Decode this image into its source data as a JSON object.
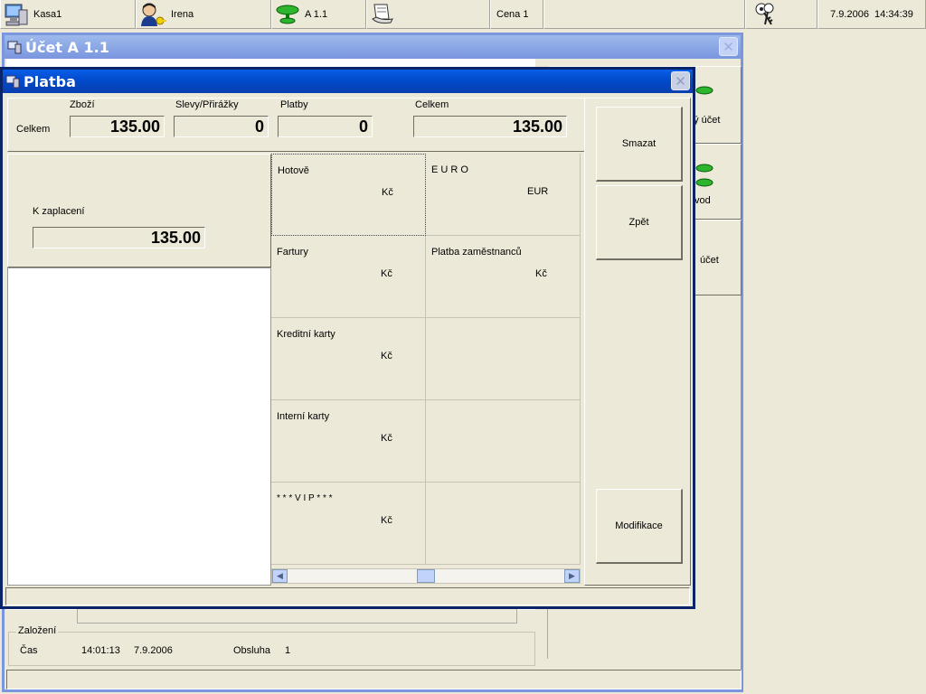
{
  "topbar": {
    "register": "Kasa1",
    "user": "Irena",
    "table": "A 1.1",
    "price_level": "Cena 1",
    "datetime": "7.9.2006  14:34:39"
  },
  "bg_window": {
    "title": "Účet A 1.1",
    "right_buttons": [
      "ný účet",
      "vod",
      "účet"
    ],
    "founded_label": "Založení",
    "time_label": "Čas",
    "time": "14:01:13",
    "date": "7.9.2006",
    "staff_label": "Obsluha",
    "staff": "1"
  },
  "dialog": {
    "title": "Platba",
    "totals": {
      "row_label": "Celkem",
      "goods_label": "Zboží",
      "goods": "135.00",
      "discounts_label": "Slevy/Přirážky",
      "discounts": "0",
      "payments_label": "Platby",
      "payments": "0",
      "total_label": "Celkem",
      "total": "135.00"
    },
    "to_pay_label": "K zaplacení",
    "to_pay": "135.00",
    "methods": [
      {
        "name": "Hotově",
        "currency": "Kč"
      },
      {
        "name": "E U R O",
        "currency": "EUR"
      },
      {
        "name": "Fartury",
        "currency": "Kč"
      },
      {
        "name": "Platba zaměstnanců",
        "currency": "Kč"
      },
      {
        "name": "Kreditní karty",
        "currency": "Kč"
      },
      {
        "name": "",
        "currency": ""
      },
      {
        "name": "Interní karty",
        "currency": "Kč"
      },
      {
        "name": "",
        "currency": ""
      },
      {
        "name": "* * * V I P * * *",
        "currency": "Kč"
      },
      {
        "name": "",
        "currency": ""
      }
    ],
    "buttons": {
      "delete": "Smazat",
      "back": "Zpět",
      "modify": "Modifikace"
    }
  },
  "colors": {
    "active_title": "#0049c8",
    "inactive_title": "#7a96df",
    "face": "#ece9d8"
  }
}
